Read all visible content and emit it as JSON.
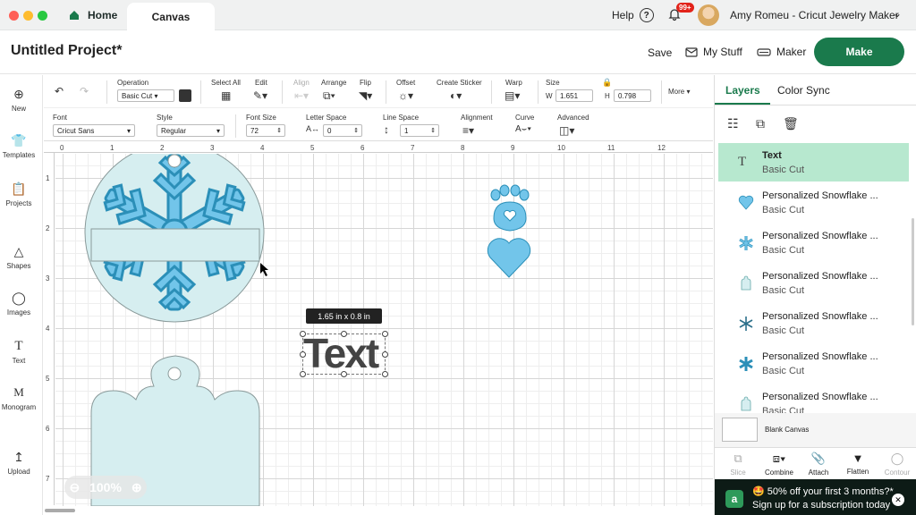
{
  "tabs": {
    "home": "Home",
    "canvas": "Canvas"
  },
  "topbar": {
    "help": "Help",
    "notifications": "99+",
    "user": "Amy Romeu - Cricut Jewelry Maker"
  },
  "header": {
    "title": "Untitled Project*",
    "save": "Save",
    "my_stuff": "My Stuff",
    "machine": "Maker",
    "make": "Make"
  },
  "left_tools": [
    "New",
    "Templates",
    "Projects",
    "Shapes",
    "Images",
    "Text",
    "Monogram",
    "Upload"
  ],
  "toolbar1": {
    "operation_label": "Operation",
    "operation_value": "Basic Cut",
    "select_all": "Select All",
    "edit": "Edit",
    "align": "Align",
    "arrange": "Arrange",
    "flip": "Flip",
    "offset": "Offset",
    "create_sticker": "Create Sticker",
    "warp": "Warp",
    "size": "Size",
    "w_label": "W",
    "w_value": "1.651",
    "h_label": "H",
    "h_value": "0.798",
    "more": "More"
  },
  "toolbar2": {
    "font_label": "Font",
    "font_value": "Cricut Sans",
    "style_label": "Style",
    "style_value": "Regular",
    "font_size_label": "Font Size",
    "font_size_value": "72",
    "letter_space_label": "Letter Space",
    "letter_space_value": "0",
    "line_space_label": "Line Space",
    "line_space_value": "1",
    "alignment_label": "Alignment",
    "curve_label": "Curve",
    "advanced_label": "Advanced"
  },
  "ruler_top": [
    "0",
    "1",
    "2",
    "3",
    "4",
    "5",
    "6",
    "7",
    "8",
    "9",
    "10",
    "11",
    "12"
  ],
  "ruler_left": [
    "1",
    "2",
    "3",
    "4",
    "5",
    "6",
    "7"
  ],
  "canvas": {
    "size_tooltip": "1.65  in x 0.8  in",
    "text_object": "Text",
    "zoom": "100%"
  },
  "right_panel": {
    "tab_layers": "Layers",
    "tab_color_sync": "Color Sync",
    "layers": [
      {
        "name": "Text",
        "type": "Basic Cut",
        "icon": "text-icon"
      },
      {
        "name": "Personalized Snowflake ...",
        "type": "Basic Cut",
        "icon": "heart-icon"
      },
      {
        "name": "Personalized Snowflake ...",
        "type": "Basic Cut",
        "icon": "snowflake-icon"
      },
      {
        "name": "Personalized Snowflake ...",
        "type": "Basic Cut",
        "icon": "shape-outline-icon"
      },
      {
        "name": "Personalized Snowflake ...",
        "type": "Basic Cut",
        "icon": "snowflake-icon"
      },
      {
        "name": "Personalized Snowflake ...",
        "type": "Basic Cut",
        "icon": "snowflake-icon"
      },
      {
        "name": "Personalized Snowflake ...",
        "type": "Basic Cut",
        "icon": "shape-outline-icon"
      }
    ],
    "blank_canvas": "Blank Canvas",
    "bottom_tools": [
      "Slice",
      "Combine",
      "Attach",
      "Flatten",
      "Contour"
    ],
    "promo_line1": "🤩 50% off your first 3 months?*",
    "promo_line2": "Sign up for a subscription today"
  },
  "colors": {
    "accent": "#1a7a4c",
    "shape_light": "#d6eef0",
    "shape_blue": "#72c5ea",
    "shape_dark": "#2b8fb8",
    "selected_layer": "#b7e8cf"
  }
}
